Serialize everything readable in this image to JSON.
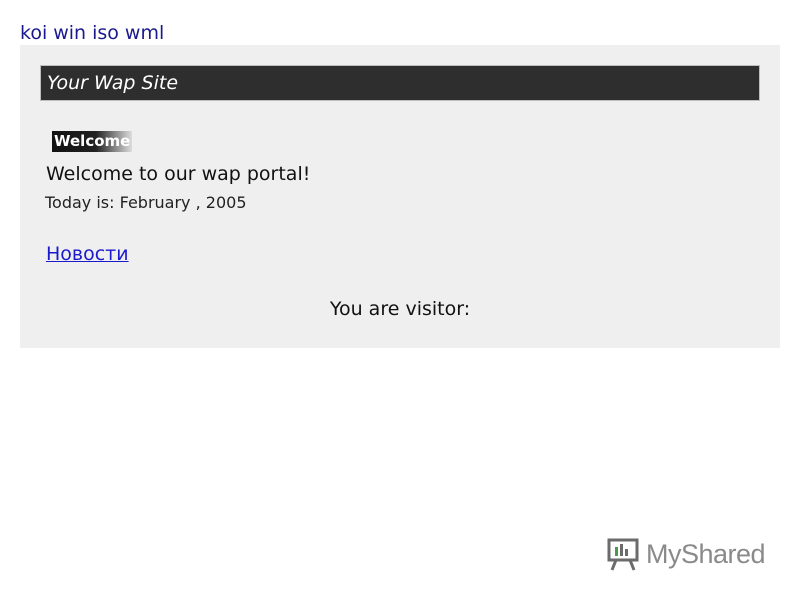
{
  "encoding_bar": {
    "items": [
      "koi",
      "win",
      "iso",
      "wml"
    ]
  },
  "site": {
    "title": "Your Wap Site",
    "welcome_image_text": "Welcome",
    "greeting": "Welcome to our wap portal!",
    "date_line": "Today is: February , 2005",
    "news_link": "Новости",
    "visitor_text": "You are visitor:"
  },
  "watermark": {
    "text": "MyShared",
    "icon": "presentation-board-icon"
  },
  "colors": {
    "link": "#1a1acc",
    "encoding_link": "#1a1a8c",
    "panel_bg": "#efefef",
    "title_bar_bg": "#2e2e2e"
  }
}
